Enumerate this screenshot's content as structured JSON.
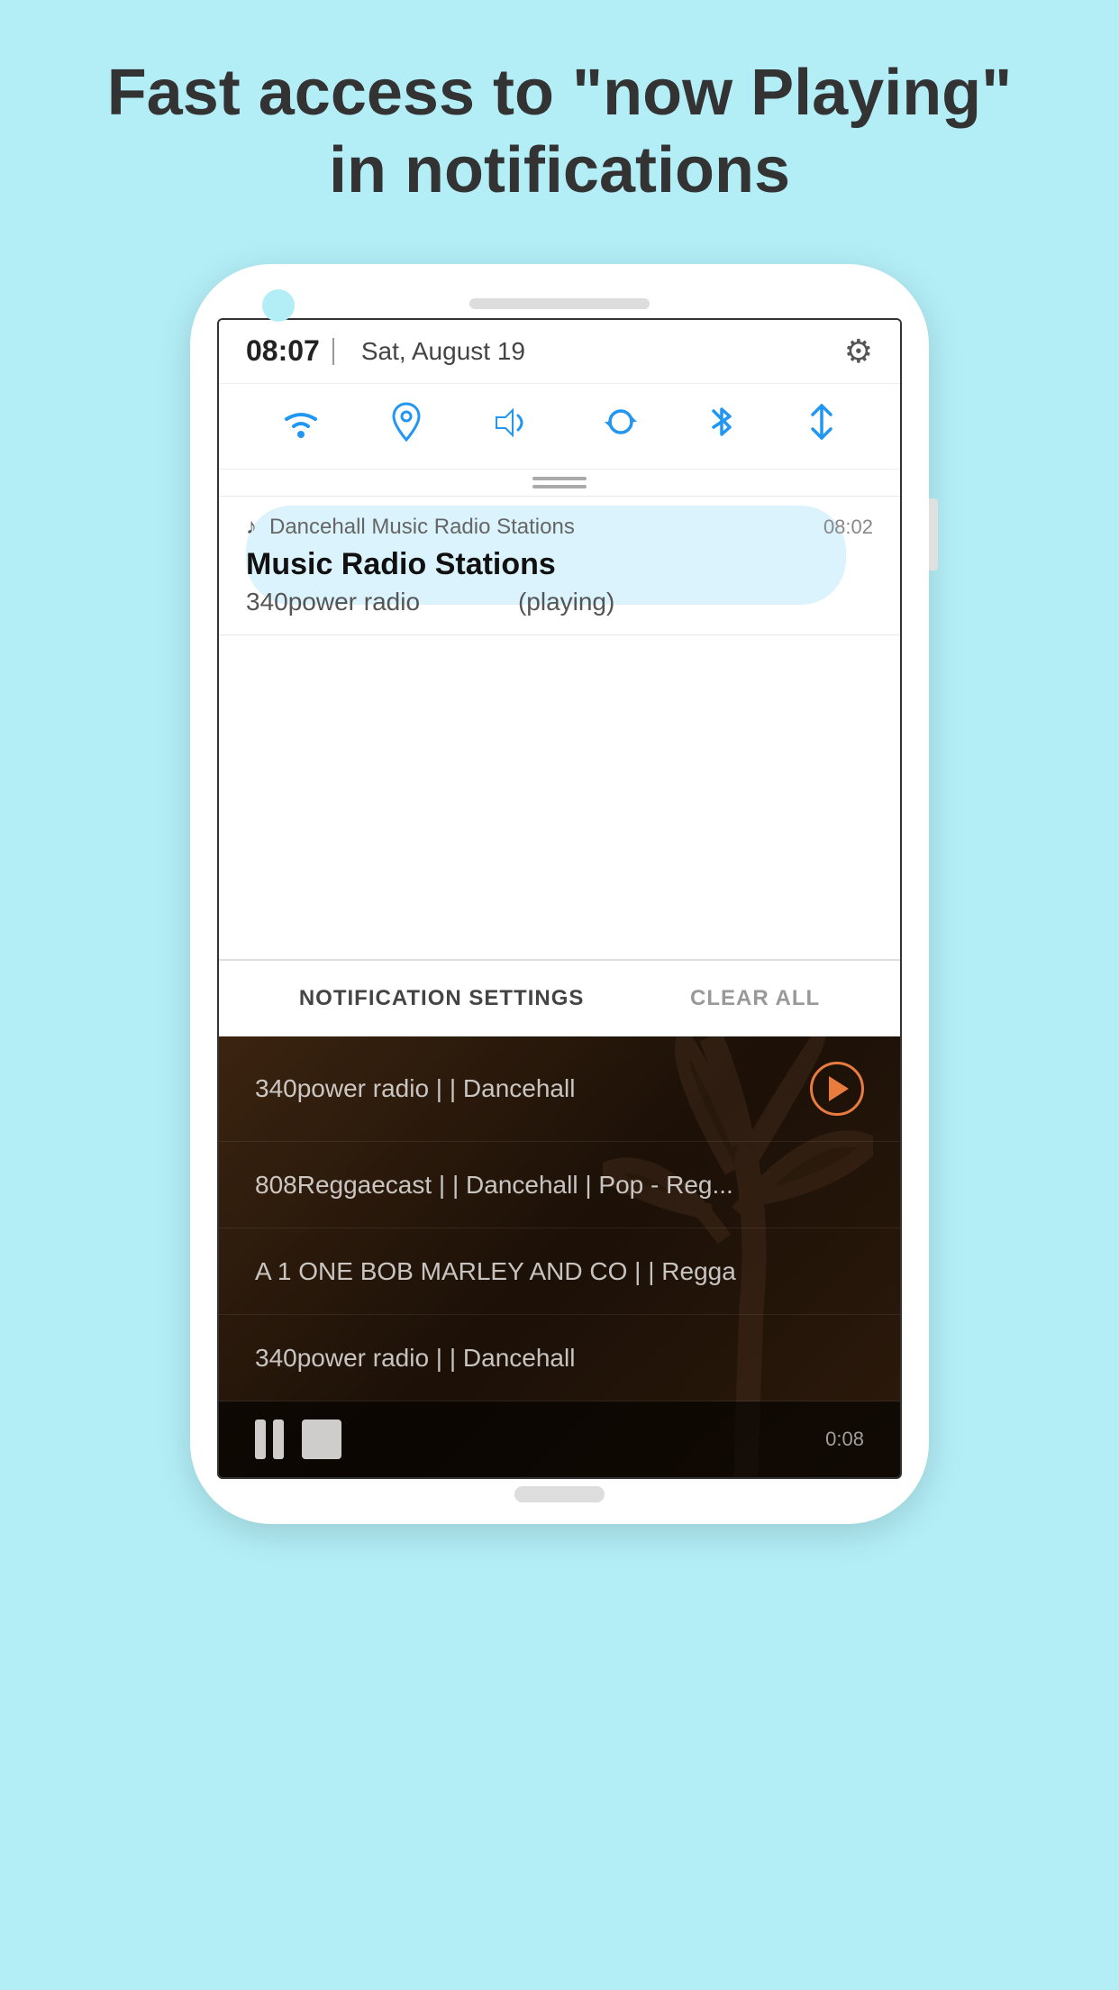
{
  "page": {
    "background_color": "#b3eef7",
    "headline": "Fast access to \"now Playing\" in notifications"
  },
  "phone": {
    "screen": {
      "status_bar": {
        "time": "08:07",
        "separator": "|",
        "date": "Sat, August 19",
        "gear_icon": "⚙"
      },
      "quick_settings": {
        "icons": [
          {
            "name": "wifi-icon",
            "symbol": "📶"
          },
          {
            "name": "location-icon",
            "symbol": "📍"
          },
          {
            "name": "volume-icon",
            "symbol": "🔊"
          },
          {
            "name": "sync-icon",
            "symbol": "🔄"
          },
          {
            "name": "bluetooth-icon",
            "symbol": "⬡"
          },
          {
            "name": "data-icon",
            "symbol": "⇅"
          }
        ]
      },
      "notification": {
        "app_icon": "♪",
        "app_name": "Dancehall Music Radio Stations",
        "time": "08:02",
        "title": "Music Radio Stations",
        "station": "340power radio",
        "status": "(playing)"
      },
      "notification_buttons": {
        "settings_label": "NOTIFICATION SETTINGS",
        "clear_label": "CLEAR ALL"
      },
      "radio_list": {
        "items": [
          {
            "name": "340power radio | | Dancehall",
            "has_play": true
          },
          {
            "name": "808Reggaecast | | Dancehall | Pop - Reg...",
            "has_play": false
          },
          {
            "name": "A 1 ONE BOB MARLEY AND CO | | Regga",
            "has_play": false
          },
          {
            "name": "340power radio | | Dancehall",
            "has_play": false
          }
        ]
      },
      "player": {
        "station": "340power radio | | Dancehall",
        "time": "0:08"
      }
    }
  }
}
